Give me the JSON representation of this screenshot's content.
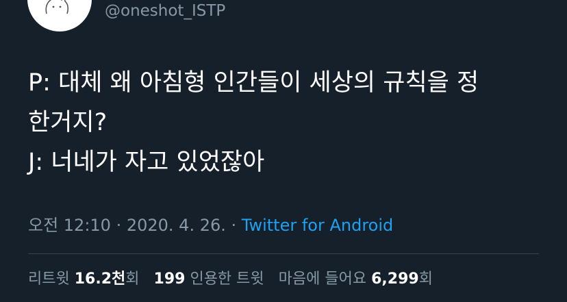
{
  "profile": {
    "handle": "@oneshot_ISTP",
    "avatar_icon": "cat-doodle-icon"
  },
  "tweet": {
    "lines": [
      "P: 대체 왜 아침형 인간들이 세상의 규칙을 정",
      "한거지?",
      "J: 너네가 자고 있었잖아"
    ]
  },
  "meta": {
    "time": "오전 12:10",
    "sep1": " · ",
    "date": "2020. 4. 26.",
    "sep2": " · ",
    "source": "Twitter for Android"
  },
  "stats": {
    "retweets_label": "리트윗",
    "retweets_value": "16.2천",
    "retweets_suffix": "회",
    "quotes_value": "199",
    "quotes_label": "인용한 트윗",
    "likes_label": "마음에 들어요",
    "likes_value": "6,299",
    "likes_suffix": "회"
  },
  "colors": {
    "background": "#15202b",
    "secondary_text": "#8899a6",
    "link": "#1da1f2"
  }
}
